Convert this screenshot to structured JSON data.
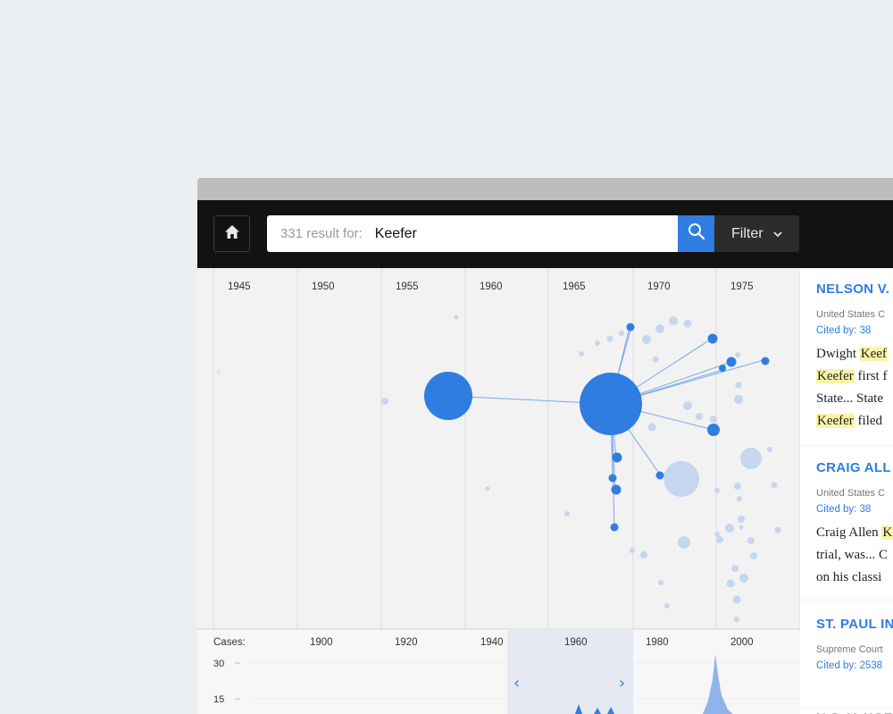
{
  "search": {
    "result_prefix": "331 result for:",
    "query": "Keefer",
    "filter_label": "Filter"
  },
  "timeline": {
    "year_labels": [
      "1945",
      "1950",
      "1955",
      "1960",
      "1965",
      "1970",
      "1975"
    ],
    "nodes": [
      {
        "year": 1958,
        "size": "large",
        "cited": true
      },
      {
        "year": 1967.5,
        "size": "xlarge",
        "cited": true
      },
      {
        "year": 1968.5,
        "size": "small",
        "cited": true
      },
      {
        "year": 1968.2,
        "size": "small",
        "cited": true
      },
      {
        "year": 1968,
        "size": "small",
        "cited": true
      },
      {
        "year": 1968.1,
        "size": "small",
        "cited": true
      },
      {
        "year": 1970,
        "size": "small",
        "cited": true
      },
      {
        "year": 1974.9,
        "size": "small",
        "cited": true
      },
      {
        "year": 1974.9,
        "size": "small",
        "cited": true
      },
      {
        "year": 1975,
        "size": "small",
        "cited": true
      },
      {
        "year": 1976,
        "size": "small",
        "cited": true
      },
      {
        "year": 1977.9,
        "size": "small",
        "cited": true
      },
      {
        "year": 1968.5,
        "size": "small",
        "cited": true
      }
    ]
  },
  "histogram": {
    "cases_label": "Cases:",
    "x_labels": [
      "1900",
      "1920",
      "1940",
      "1960",
      "1980",
      "2000"
    ],
    "y_ticks": [
      "30",
      "15"
    ],
    "prev_symbol": "‹",
    "next_symbol": "›"
  },
  "results": [
    {
      "title": "NELSON V.",
      "court": "United States C",
      "cited": "Cited by: 38",
      "lines": [
        [
          {
            "t": "Dwight "
          },
          {
            "t": "Keef",
            "hl": true
          }
        ],
        [
          {
            "t": "Keefer",
            "hl": true
          },
          {
            "t": " first f"
          }
        ],
        [
          {
            "t": "State... State"
          }
        ],
        [
          {
            "t": "Keefer",
            "hl": true
          },
          {
            "t": " filed"
          }
        ]
      ]
    },
    {
      "title": "CRAIG ALL",
      "court": "United States C",
      "cited": "Cited by: 38",
      "lines": [
        [
          {
            "t": "Craig Allen "
          },
          {
            "t": "K",
            "hl": true
          }
        ],
        [
          {
            "t": "trial, was... C"
          }
        ],
        [
          {
            "t": "on his classi"
          }
        ]
      ]
    },
    {
      "title": "ST. PAUL IN",
      "court": "Supreme Court",
      "cited": "Cited by: 2538",
      "lines": []
    },
    {
      "title": "U.S. V. HOF",
      "court": "",
      "cited": "",
      "lines": []
    }
  ],
  "colors": {
    "accent": "#2f7de1",
    "node_faint": "#c6d6ee",
    "highlight": "#fbf4a6",
    "toolbar_bg": "#121212"
  }
}
